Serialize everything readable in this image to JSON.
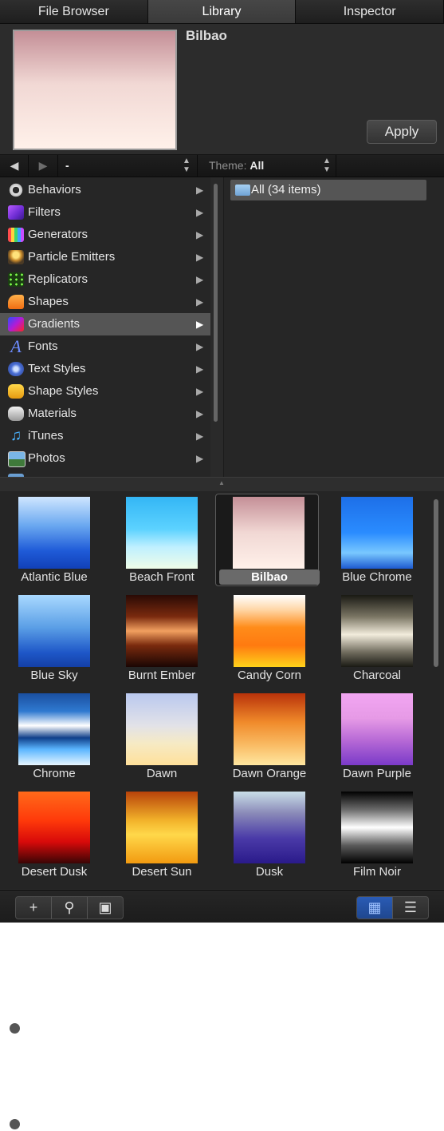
{
  "tabs": [
    {
      "label": "File Browser",
      "active": false
    },
    {
      "label": "Library",
      "active": true
    },
    {
      "label": "Inspector",
      "active": false
    }
  ],
  "preview": {
    "title": "Bilbao",
    "apply_label": "Apply"
  },
  "navbar": {
    "back_icon": "left-arrow",
    "forward_icon": "right-arrow",
    "path": "-",
    "theme_label": "Theme:",
    "theme_value": "All"
  },
  "categories": [
    {
      "label": "Behaviors",
      "icon": "gear-icon",
      "selected": false
    },
    {
      "label": "Filters",
      "icon": "filters-icon",
      "selected": false
    },
    {
      "label": "Generators",
      "icon": "generators-icon",
      "selected": false
    },
    {
      "label": "Particle Emitters",
      "icon": "particle-icon",
      "selected": false
    },
    {
      "label": "Replicators",
      "icon": "replicator-icon",
      "selected": false
    },
    {
      "label": "Shapes",
      "icon": "shapes-icon",
      "selected": false
    },
    {
      "label": "Gradients",
      "icon": "gradients-icon",
      "selected": true
    },
    {
      "label": "Fonts",
      "icon": "fonts-icon",
      "selected": false
    },
    {
      "label": "Text Styles",
      "icon": "text-styles-icon",
      "selected": false
    },
    {
      "label": "Shape Styles",
      "icon": "shape-styles-icon",
      "selected": false
    },
    {
      "label": "Materials",
      "icon": "materials-icon",
      "selected": false
    },
    {
      "label": "iTunes",
      "icon": "itunes-icon",
      "selected": false
    },
    {
      "label": "Photos",
      "icon": "photos-icon",
      "selected": false
    }
  ],
  "sub_items": [
    {
      "label": "All (34 items)",
      "icon": "folder-icon"
    }
  ],
  "gradients": [
    {
      "label": "Atlantic Blue",
      "selected": false
    },
    {
      "label": "Beach Front",
      "selected": false
    },
    {
      "label": "Bilbao",
      "selected": true
    },
    {
      "label": "Blue Chrome",
      "selected": false
    },
    {
      "label": "Blue Sky",
      "selected": false
    },
    {
      "label": "Burnt Ember",
      "selected": false
    },
    {
      "label": "Candy Corn",
      "selected": false
    },
    {
      "label": "Charcoal",
      "selected": false
    },
    {
      "label": "Chrome",
      "selected": false
    },
    {
      "label": "Dawn",
      "selected": false
    },
    {
      "label": "Dawn Orange",
      "selected": false
    },
    {
      "label": "Dawn Purple",
      "selected": false
    },
    {
      "label": "Desert Dusk",
      "selected": false
    },
    {
      "label": "Desert Sun",
      "selected": false
    },
    {
      "label": "Dusk",
      "selected": false
    },
    {
      "label": "Film Noir",
      "selected": false
    }
  ],
  "bottombar": {
    "left_buttons": [
      {
        "icon": "add-icon",
        "glyph": "+"
      },
      {
        "icon": "search-icon",
        "glyph": "⚲"
      },
      {
        "icon": "preview-icon",
        "glyph": "▣"
      }
    ],
    "right_buttons": [
      {
        "icon": "grid-view-icon",
        "glyph": "▦",
        "active": true
      },
      {
        "icon": "list-view-icon",
        "glyph": "☰",
        "active": false
      }
    ]
  }
}
